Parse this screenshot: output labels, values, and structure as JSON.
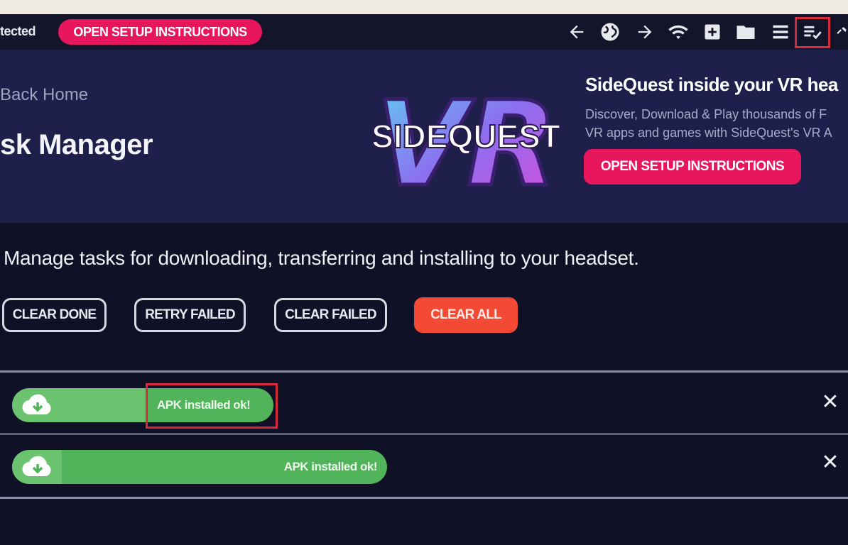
{
  "topbar": {
    "status_text": "tected",
    "setup_button": "OPEN SETUP INSTRUCTIONS",
    "icons": [
      "back-arrow-icon",
      "globe-icon",
      "forward-arrow-icon",
      "wifi-icon",
      "add-box-icon",
      "folder-icon",
      "menu-icon",
      "tasks-icon",
      "tools-icon"
    ]
  },
  "hero": {
    "back_link": "Back Home",
    "title": "sk Manager",
    "logo_text": "SIDEQUEST",
    "logo_bg_text": "VR",
    "promo_title": "SideQuest inside your VR hea",
    "promo_desc": [
      "Discover, Download & Play thousands of F",
      "VR apps and games with SideQuest's VR A"
    ],
    "promo_button": "OPEN SETUP INSTRUCTIONS"
  },
  "main": {
    "description": "Manage tasks for downloading, transferring and installing to your headset.",
    "buttons": {
      "clear_done": "CLEAR DONE",
      "retry_failed": "RETRY FAILED",
      "clear_failed": "CLEAR FAILED",
      "clear_all": "CLEAR ALL"
    },
    "tasks": [
      {
        "label": "APK installed ok!",
        "progress": 1.0
      },
      {
        "label": "APK installed ok!",
        "progress": 1.0
      }
    ],
    "close_glyph": "✕"
  },
  "colors": {
    "accent_pink": "#e8175d",
    "clear_all_red": "#f24a35",
    "progress_green": "#52b45a",
    "highlight_red": "#d92a3c",
    "hero_bg": "#1e1f4a",
    "main_bg": "#101126"
  }
}
